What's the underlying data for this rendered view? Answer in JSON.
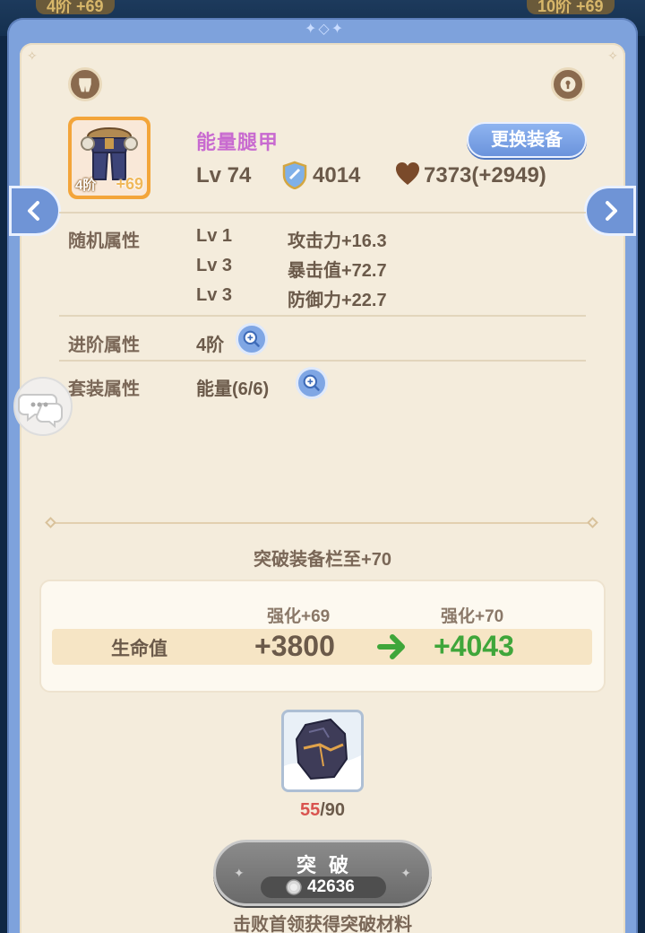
{
  "background_chips": {
    "left": "4阶 +69",
    "right": "10阶 +69"
  },
  "item": {
    "name": "能量腿甲",
    "tier": "4阶",
    "enhance": "+69",
    "level": "Lv 74",
    "power": "4014",
    "hp": "7373(+2949)",
    "change_button": "更换装备"
  },
  "random_attrs": {
    "label": "随机属性",
    "rows": [
      {
        "lv": "Lv 1",
        "stat": "攻击力+16.3"
      },
      {
        "lv": "Lv 3",
        "stat": "暴击值+72.7"
      },
      {
        "lv": "Lv 3",
        "stat": "防御力+22.7"
      }
    ]
  },
  "advance_attrs": {
    "label": "进阶属性",
    "value": "4阶"
  },
  "set_attrs": {
    "label": "套装属性",
    "value": "能量(6/6)"
  },
  "breakthrough": {
    "title": "突破装备栏至+70",
    "from_label": "强化+69",
    "to_label": "强化+70",
    "stat_name": "生命值",
    "from_value": "+3800",
    "to_value": "+4043",
    "material_have": "55",
    "material_need": "/90",
    "button_label": "突破",
    "cost": "42636",
    "hint": "击败首领获得突破材料"
  },
  "colors": {
    "accent": "#7ea2dc",
    "item_name": "#c86ad0",
    "increase": "#3fa63a",
    "insufficient": "#d9534f"
  }
}
